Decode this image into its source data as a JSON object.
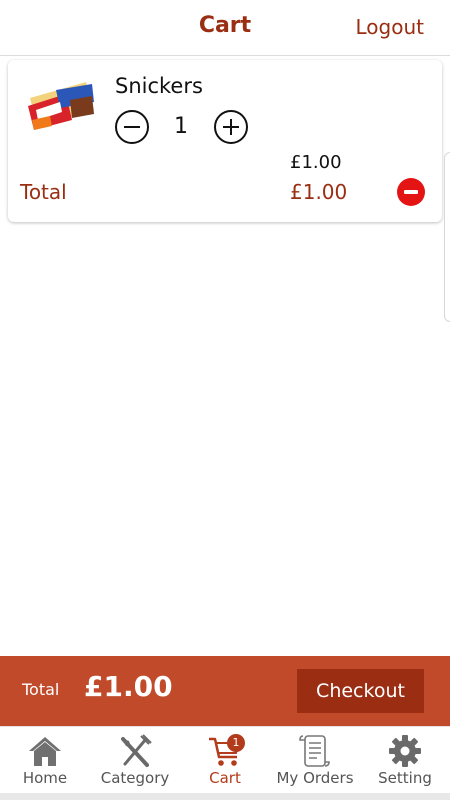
{
  "header": {
    "title": "Cart",
    "logout_label": "Logout"
  },
  "cart": {
    "items": [
      {
        "name": "Snickers",
        "quantity": "1",
        "unit_price": "£1.00",
        "total_label": "Total",
        "total_price": "£1.00"
      }
    ]
  },
  "checkout_bar": {
    "total_label": "Total",
    "total_amount": "£1.00",
    "checkout_label": "Checkout"
  },
  "bottom_nav": {
    "items": [
      {
        "label": "Home",
        "icon": "home-icon"
      },
      {
        "label": "Category",
        "icon": "fork-knife-icon"
      },
      {
        "label": "Cart",
        "icon": "cart-icon",
        "badge": "1",
        "active": true
      },
      {
        "label": "My Orders",
        "icon": "receipt-scroll-icon"
      },
      {
        "label": "Setting",
        "icon": "gear-icon"
      }
    ]
  },
  "colors": {
    "brand": "#9a2e12",
    "checkout_bar": "#c04a2a",
    "checkout_button": "#9b2e12",
    "remove": "#e41414",
    "nav_inactive": "#666666"
  }
}
